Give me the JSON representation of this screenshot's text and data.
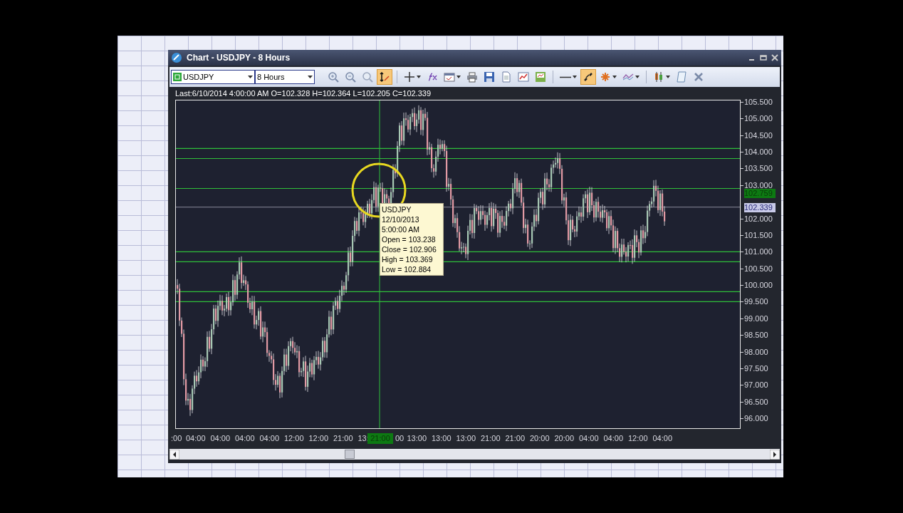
{
  "window": {
    "title": "Chart - USDJPY - 8 Hours"
  },
  "toolbar": {
    "symbol": "USDJPY",
    "timeframe": "8 Hours",
    "tools": [
      {
        "kind": "zoom-in",
        "selected": false,
        "dropdown": false
      },
      {
        "kind": "zoom-out",
        "selected": false,
        "dropdown": false
      },
      {
        "kind": "zoom-fit",
        "selected": false,
        "dropdown": false
      },
      {
        "kind": "cursor",
        "selected": true,
        "dropdown": false
      },
      {
        "kind": "crosshair",
        "selected": false,
        "dropdown": true
      },
      {
        "kind": "function",
        "selected": false,
        "dropdown": false
      },
      {
        "kind": "window",
        "selected": false,
        "dropdown": true
      },
      {
        "kind": "print",
        "selected": false,
        "dropdown": false
      },
      {
        "kind": "save",
        "selected": false,
        "dropdown": false
      },
      {
        "kind": "document",
        "selected": false,
        "dropdown": false
      },
      {
        "kind": "chart",
        "selected": false,
        "dropdown": false
      },
      {
        "kind": "chart-save",
        "selected": false,
        "dropdown": false
      },
      {
        "kind": "line",
        "selected": false,
        "dropdown": true
      },
      {
        "kind": "link",
        "selected": true,
        "dropdown": false
      },
      {
        "kind": "bug",
        "selected": false,
        "dropdown": true
      },
      {
        "kind": "indicator",
        "selected": false,
        "dropdown": true
      },
      {
        "kind": "candles",
        "selected": false,
        "dropdown": true
      },
      {
        "kind": "note",
        "selected": false,
        "dropdown": false
      },
      {
        "kind": "tools",
        "selected": false,
        "dropdown": false
      }
    ]
  },
  "info_line": "Last:6/10/2014 4:00:00 AM O=102.328 H=102.364 L=102.205 C=102.339",
  "chart": {
    "y_labels": [
      "105.500",
      "105.000",
      "104.500",
      "104.000",
      "103.500",
      "103.000",
      "102.000",
      "101.500",
      "101.000",
      "100.500",
      "100.000",
      "99.500",
      "99.000",
      "98.500",
      "98.000",
      "97.500",
      "97.000",
      "96.500",
      "96.000"
    ],
    "price_badges": [
      {
        "text": "102.759",
        "kind": "level"
      },
      {
        "text": "102.339",
        "kind": "last"
      }
    ],
    "x_labels": [
      ":00",
      "04:00",
      "04:00",
      "04:00",
      "04:00",
      "12:00",
      "12:00",
      "21:00",
      "13:",
      "00",
      "13:00",
      "13:00",
      "13:00",
      "21:00",
      "21:00",
      "20:00",
      "20:00",
      "04:00",
      "04:00",
      "12:00",
      "04:00"
    ],
    "crosshair_label": "21:00",
    "tooltip": [
      "USDJPY",
      "12/10/2013",
      "5:00:00 AM",
      "Open = 103.238",
      "Close = 102.906",
      "High = 103.369",
      "Low = 102.884"
    ]
  }
}
